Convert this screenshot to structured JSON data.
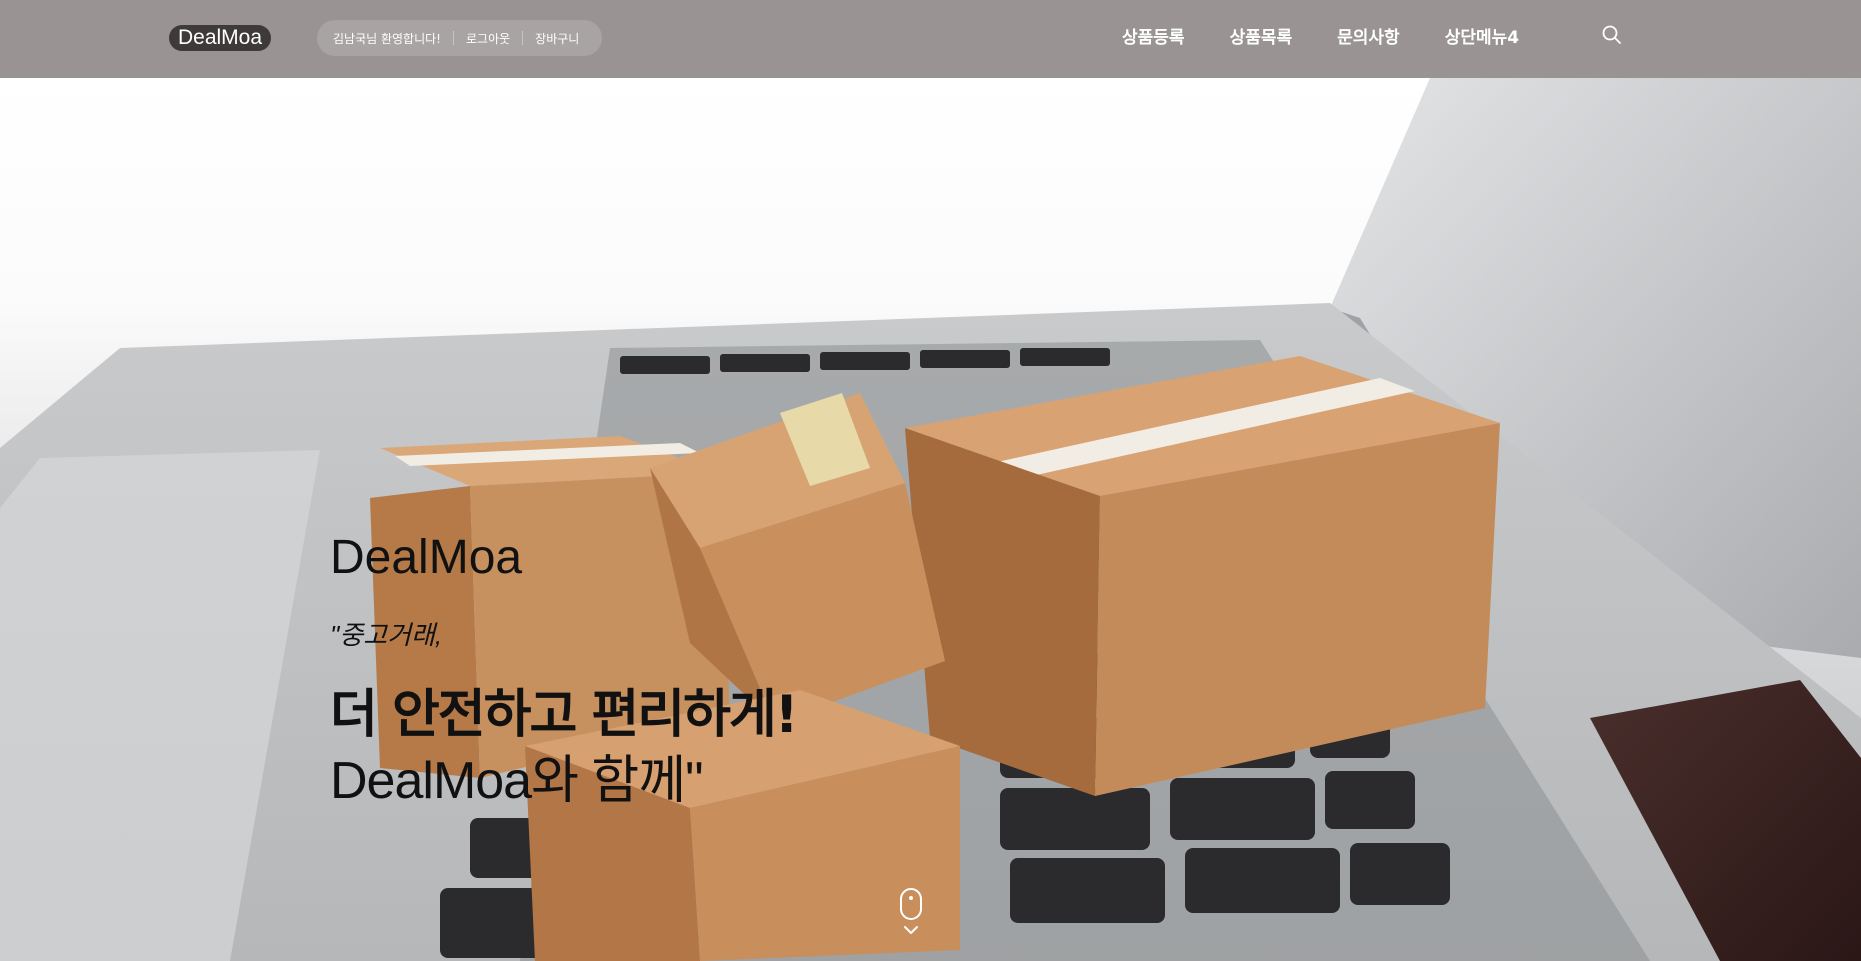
{
  "header": {
    "logo": "DealMoa",
    "user": {
      "welcome": "김남국님 환영합니다!",
      "logout": "로그아웃",
      "cart": "장바구니"
    },
    "nav": [
      "상품등록",
      "상품목록",
      "문의사항",
      "상단메뉴4"
    ],
    "search_icon": "search-icon"
  },
  "hero": {
    "brand": "DealMoa",
    "quote": "\"중고거래,",
    "headline": "더 안전하고 편리하게!",
    "subline": "DealMoa와 함께\"",
    "scroll_icon": "scroll-down-icon"
  },
  "colors": {
    "header_bg": "#999393",
    "logo_bg": "#3f3a3a",
    "box": "#c48b5a"
  }
}
